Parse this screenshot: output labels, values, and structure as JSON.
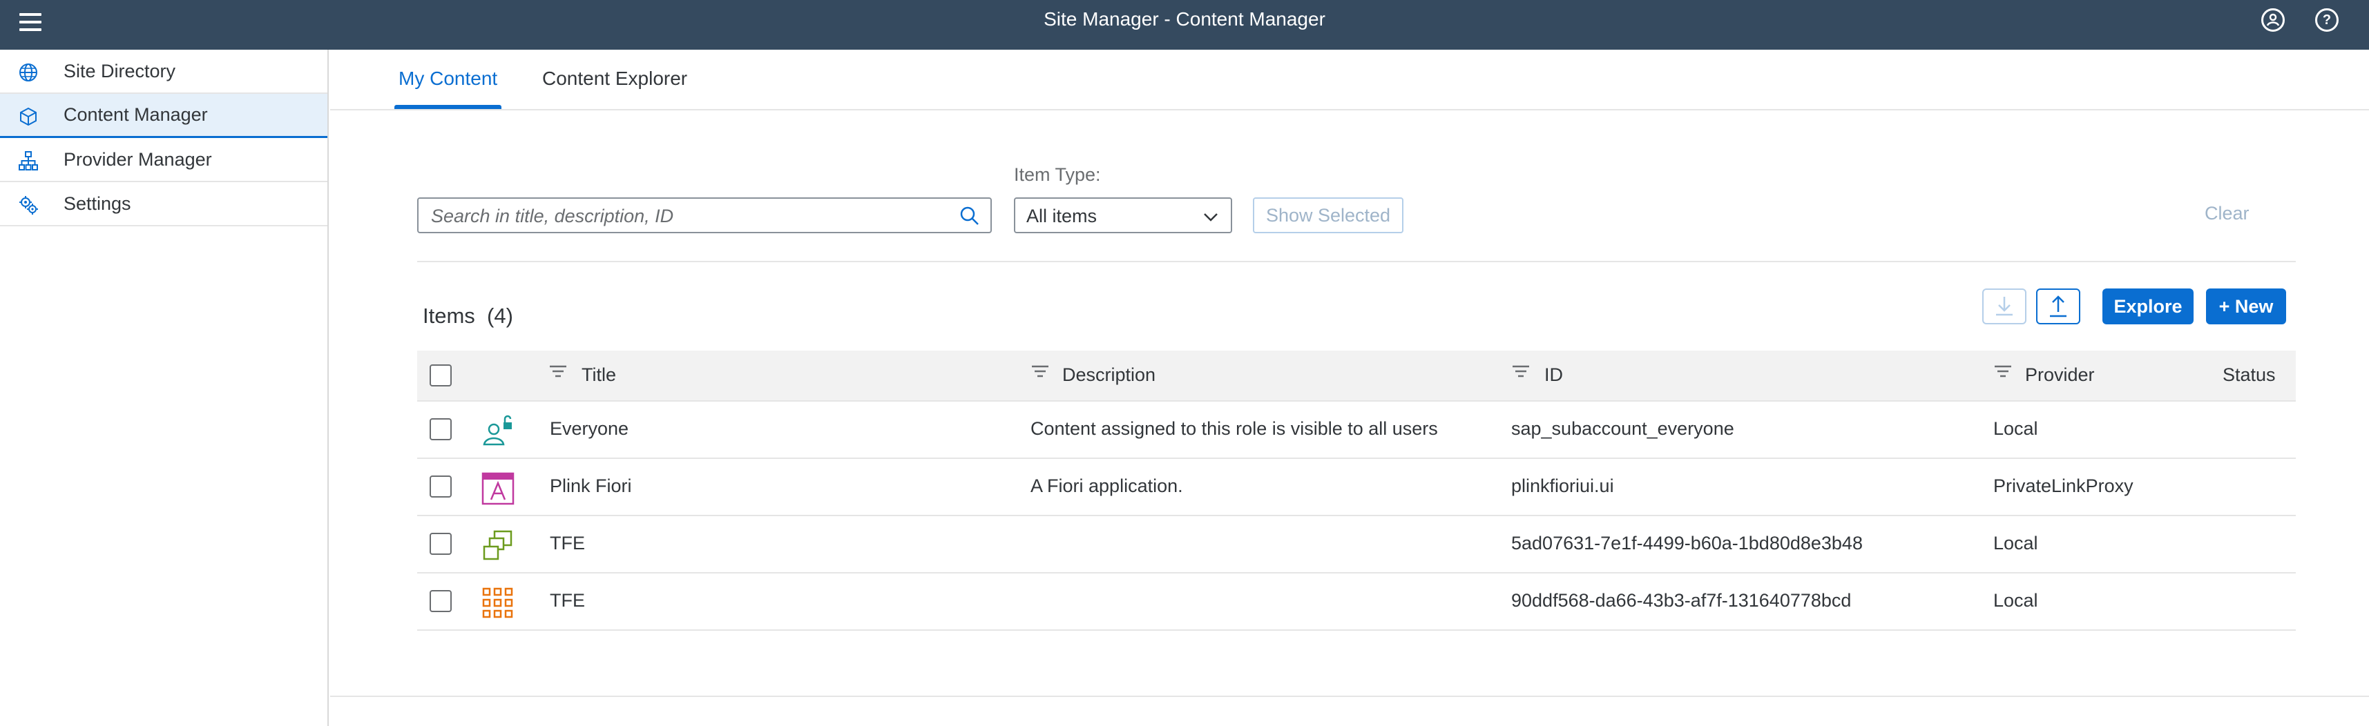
{
  "app": {
    "title": "Site Manager - Content Manager"
  },
  "shell": {
    "menu_icon": "hamburger-icon",
    "user_icon": "user-icon",
    "help_icon": "help-icon",
    "help_glyph": "?"
  },
  "sidebar": {
    "items": [
      {
        "label": "Site Directory",
        "icon": "globe-icon",
        "selected": false
      },
      {
        "label": "Content Manager",
        "icon": "cube-icon",
        "selected": true
      },
      {
        "label": "Provider Manager",
        "icon": "hierarchy-icon",
        "selected": false
      },
      {
        "label": "Settings",
        "icon": "gears-icon",
        "selected": false
      }
    ]
  },
  "tabs": [
    {
      "label": "My Content",
      "active": true
    },
    {
      "label": "Content Explorer",
      "active": false
    }
  ],
  "filters": {
    "search_placeholder": "Search in title, description, ID",
    "item_type_label": "Item Type:",
    "item_type_value": "All items",
    "show_selected_label": "Show Selected",
    "clear_label": "Clear"
  },
  "toolbar": {
    "items_title": "Items  (4)",
    "download_icon": "download-icon",
    "upload_icon": "upload-icon",
    "explore_label": "Explore",
    "new_label": "+ New"
  },
  "table": {
    "columns": [
      "Title",
      "Description",
      "ID",
      "Provider",
      "Status"
    ],
    "rows": [
      {
        "icon": "role-unlock-icon",
        "title": "Everyone",
        "description": "Content assigned to this role is visible to all users",
        "id": "sap_subaccount_everyone",
        "provider": "Local",
        "status": ""
      },
      {
        "icon": "app-a-icon",
        "title": "Plink Fiori",
        "description": "A Fiori application.",
        "id": "plinkfioriui.ui",
        "provider": "PrivateLinkProxy",
        "status": ""
      },
      {
        "icon": "group-copy-icon",
        "title": "TFE",
        "description": "",
        "id": "5ad07631-7e1f-4499-b60a-1bd80d8e3b48",
        "provider": "Local",
        "status": ""
      },
      {
        "icon": "catalog-grid-icon",
        "title": "TFE",
        "description": "",
        "id": "90ddf568-da66-43b3-af7f-131640778bcd",
        "provider": "Local",
        "status": ""
      }
    ]
  },
  "colors": {
    "shell_bg": "#354a5f",
    "accent": "#0a6ed1",
    "role_icon": "#1a9898",
    "app_icon": "#c0399f",
    "group_icon": "#6c9b1e",
    "catalog_icon": "#e9730c"
  }
}
